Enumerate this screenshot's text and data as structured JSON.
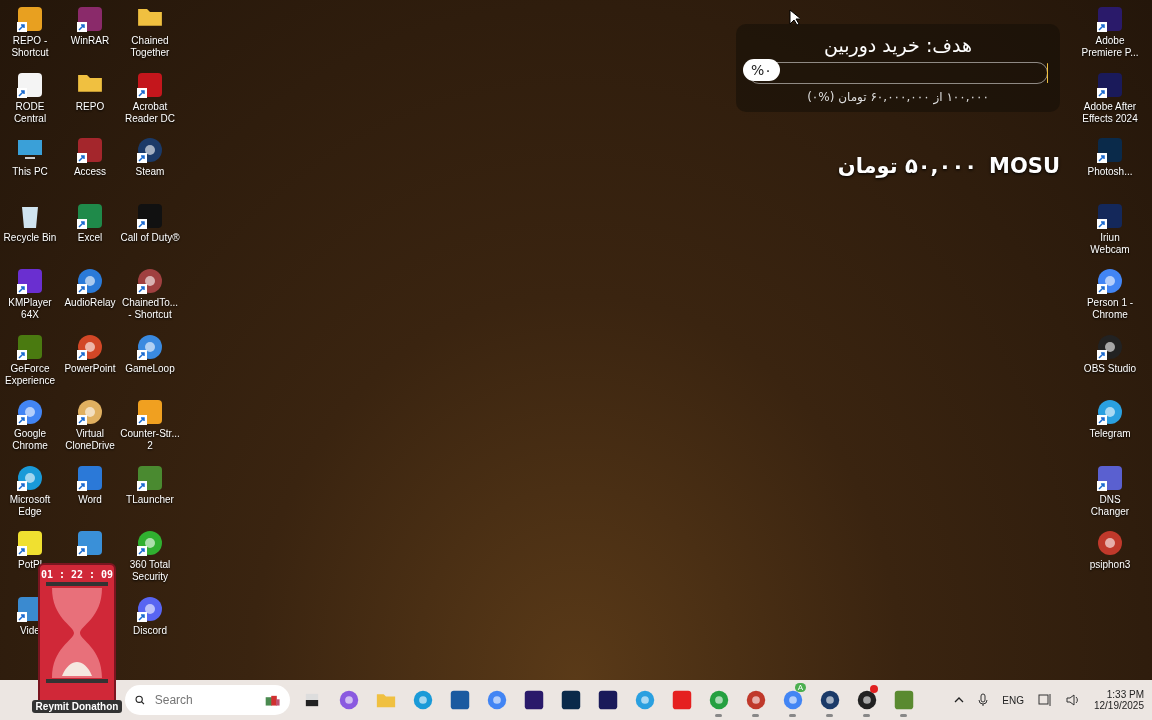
{
  "desktop": {
    "left_columns": [
      [
        {
          "label": "REPO - Shortcut",
          "kind": "tile",
          "color": "#e8a020",
          "shortcut": true
        },
        {
          "label": "RODE Central",
          "kind": "tile",
          "color": "#f4f4f4",
          "shortcut": true
        },
        {
          "label": "This PC",
          "kind": "pc",
          "color": "#3aa0d8",
          "shortcut": false
        },
        {
          "label": "Recycle Bin",
          "kind": "bin",
          "color": "#d0e4f0",
          "shortcut": false
        },
        {
          "label": "KMPlayer 64X",
          "kind": "tile",
          "color": "#6a2fd0",
          "shortcut": true
        },
        {
          "label": "GeForce Experience",
          "kind": "tile",
          "color": "#4a7a10",
          "shortcut": true
        },
        {
          "label": "Google Chrome",
          "kind": "circle",
          "color": "#4285f4",
          "shortcut": true
        },
        {
          "label": "Microsoft Edge",
          "kind": "circle",
          "color": "#1a9ad8",
          "shortcut": true
        },
        {
          "label": "PotPl",
          "kind": "tile",
          "color": "#f0e030",
          "shortcut": true
        },
        {
          "label": "Vide",
          "kind": "tile",
          "color": "#3a8ad0",
          "shortcut": true
        }
      ],
      [
        {
          "label": "WinRAR",
          "kind": "tile",
          "color": "#8a2a6a",
          "shortcut": true
        },
        {
          "label": "REPO",
          "kind": "folder",
          "color": "#f0c040",
          "shortcut": false
        },
        {
          "label": "Access",
          "kind": "tile",
          "color": "#a4262c",
          "shortcut": true
        },
        {
          "label": "Excel",
          "kind": "tile",
          "color": "#1f8a4a",
          "shortcut": true
        },
        {
          "label": "AudioRelay",
          "kind": "circle",
          "color": "#2a7ad8",
          "shortcut": true
        },
        {
          "label": "PowerPoint",
          "kind": "circle",
          "color": "#d24726",
          "shortcut": true
        },
        {
          "label": "Virtual CloneDrive",
          "kind": "circle",
          "color": "#e0b060",
          "shortcut": true
        },
        {
          "label": "Word",
          "kind": "tile",
          "color": "#2b79d8",
          "shortcut": true
        },
        {
          "kind": "tile",
          "color": "#3a90d8",
          "shortcut": true
        }
      ],
      [
        {
          "label": "Chained Together",
          "kind": "folder",
          "color": "#f0c040",
          "shortcut": false
        },
        {
          "label": "Acrobat Reader DC",
          "kind": "tile",
          "color": "#c4161c",
          "shortcut": true
        },
        {
          "label": "Steam",
          "kind": "circle",
          "color": "#1b3a68",
          "shortcut": true
        },
        {
          "label": "Call of Duty®",
          "kind": "tile",
          "color": "#111111",
          "shortcut": true
        },
        {
          "label": "ChainedTo... - Shortcut",
          "kind": "circle",
          "color": "#a04040",
          "shortcut": true
        },
        {
          "label": "GameLoop",
          "kind": "circle",
          "color": "#3a8ae0",
          "shortcut": true
        },
        {
          "label": "Counter-Str... 2",
          "kind": "tile",
          "color": "#f0a020",
          "shortcut": true
        },
        {
          "label": "TLauncher",
          "kind": "tile",
          "color": "#4a8a30",
          "shortcut": true
        },
        {
          "label": "360 Total Security",
          "kind": "circle",
          "color": "#30b030",
          "shortcut": true
        },
        {
          "label": "Discord",
          "kind": "circle",
          "color": "#5865f2",
          "shortcut": true
        }
      ]
    ],
    "right_column": [
      {
        "label": "Adobe Premiere P...",
        "kind": "tile",
        "color": "#2a1a6a",
        "shortcut": true
      },
      {
        "label": "Adobe After Effects 2024",
        "kind": "tile",
        "color": "#1a1a5a",
        "shortcut": true
      },
      {
        "label": "Photosh...",
        "kind": "tile",
        "color": "#0a2a4a",
        "shortcut": true
      },
      {
        "label": "Iriun Webcam",
        "kind": "tile",
        "color": "#14285a",
        "shortcut": true
      },
      {
        "label": "Person 1 - Chrome",
        "kind": "circle",
        "color": "#4285f4",
        "shortcut": true
      },
      {
        "label": "OBS Studio",
        "kind": "circle",
        "color": "#222222",
        "shortcut": true
      },
      {
        "label": "Telegram",
        "kind": "circle",
        "color": "#2aa0e0",
        "shortcut": true
      },
      {
        "label": "DNS Changer",
        "kind": "tile",
        "color": "#5a60d0",
        "shortcut": true
      },
      {
        "label": "psiphon3",
        "kind": "circle",
        "color": "#c0392b",
        "shortcut": false
      }
    ]
  },
  "goal_widget": {
    "title": "هدف: خرید دوربین",
    "level": 0.0017,
    "percent": "%۰",
    "caption": "۱۰۰,۰۰۰ از ۶۰,۰۰۰,۰۰۰ تومان (%۰)"
  },
  "alert": {
    "name": "MOSU",
    "amount": "۵۰,۰۰۰ تومان"
  },
  "timer_widget": {
    "time": "01 : 22 : 09",
    "label": "Reymit Donathon"
  },
  "taskbar": {
    "search": {
      "placeholder": "Search"
    },
    "apps": [
      {
        "kind": "square",
        "color": "#222222",
        "running": false
      },
      {
        "kind": "circle",
        "color": "#8a5ae0",
        "running": false
      },
      {
        "kind": "folder",
        "color": "#f0c040",
        "running": false
      },
      {
        "kind": "circle",
        "color": "#1a9ad8",
        "running": false
      },
      {
        "kind": "tile",
        "color": "#1a5aa0",
        "running": false
      },
      {
        "kind": "circle",
        "color": "#4285f4",
        "running": false
      },
      {
        "kind": "tile",
        "color": "#2a1a6a",
        "running": false
      },
      {
        "kind": "tile",
        "color": "#0a2a4a",
        "running": false
      },
      {
        "kind": "tile",
        "color": "#1a1a5a",
        "running": false
      },
      {
        "kind": "circle",
        "color": "#2aa0e0",
        "running": false
      },
      {
        "kind": "tile",
        "color": "#e52020",
        "running": false
      },
      {
        "kind": "circle",
        "color": "#25a040",
        "running": true
      },
      {
        "kind": "circle",
        "color": "#c0392b",
        "running": true
      },
      {
        "kind": "circle",
        "color": "#4285f4",
        "running": true,
        "badge": "A"
      },
      {
        "kind": "circle",
        "color": "#1b3a68",
        "running": true
      },
      {
        "kind": "circle",
        "color": "#222222",
        "running": true,
        "alert": true
      },
      {
        "kind": "tile",
        "color": "#5a8a30",
        "running": true
      }
    ],
    "language": "ENG",
    "time": "1:33 PM",
    "date": "12/19/2025"
  }
}
